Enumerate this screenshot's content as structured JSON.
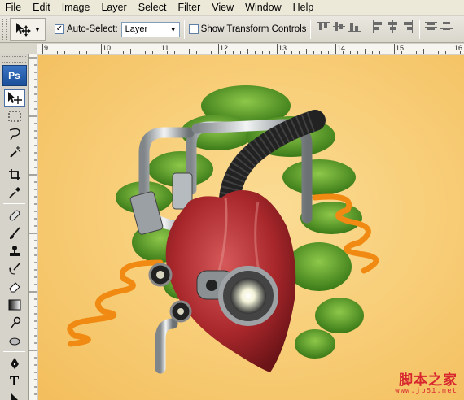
{
  "menu": [
    "File",
    "Edit",
    "Image",
    "Layer",
    "Select",
    "Filter",
    "View",
    "Window",
    "Help"
  ],
  "options": {
    "auto_select_label": "Auto-Select:",
    "auto_select_checked": true,
    "layer_select_value": "Layer",
    "show_transform_label": "Show Transform Controls",
    "show_transform_checked": false
  },
  "ruler": {
    "labels": [
      "9",
      "10",
      "11",
      "12",
      "13",
      "14",
      "15",
      "16"
    ]
  },
  "toolbox": {
    "logo": "Ps",
    "tools": [
      "move-tool",
      "marquee-tool",
      "lasso-tool",
      "magic-wand-tool",
      "crop-tool",
      "eyedropper-tool",
      "healing-brush-tool",
      "brush-tool",
      "clone-stamp-tool",
      "history-brush-tool",
      "eraser-tool",
      "gradient-tool",
      "dodge-tool",
      "sponge-tool",
      "pen-tool",
      "type-tool",
      "path-selection-tool"
    ],
    "type_tool_glyph": "T"
  },
  "watermark": {
    "main": "脚本之家",
    "sub": "www.jb51.net"
  },
  "colors": {
    "canvas_bg": "#f8cf7a",
    "heart": "#a8272b",
    "tree": "#4f8f22",
    "spring": "#f08a12",
    "watermark": "#d8262f"
  }
}
